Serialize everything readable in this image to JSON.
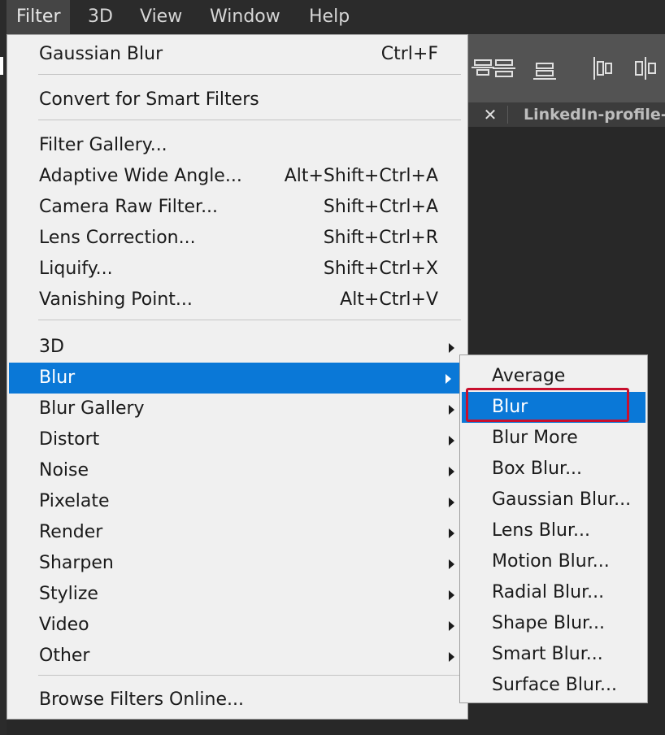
{
  "menubar": {
    "items": [
      {
        "label": "Filter"
      },
      {
        "label": "3D"
      },
      {
        "label": "View"
      },
      {
        "label": "Window"
      },
      {
        "label": "Help"
      }
    ]
  },
  "tabbar": {
    "close_glyph": "✕",
    "document_title": "LinkedIn-profile-"
  },
  "filter_menu": {
    "items": [
      {
        "label": "Gaussian Blur",
        "shortcut": "Ctrl+F"
      },
      {
        "label": "Convert for Smart Filters",
        "shortcut": ""
      },
      {
        "label": "Filter Gallery...",
        "shortcut": ""
      },
      {
        "label": "Adaptive Wide Angle...",
        "shortcut": "Alt+Shift+Ctrl+A"
      },
      {
        "label": "Camera Raw Filter...",
        "shortcut": "Shift+Ctrl+A"
      },
      {
        "label": "Lens Correction...",
        "shortcut": "Shift+Ctrl+R"
      },
      {
        "label": "Liquify...",
        "shortcut": "Shift+Ctrl+X"
      },
      {
        "label": "Vanishing Point...",
        "shortcut": "Alt+Ctrl+V"
      },
      {
        "label": "3D"
      },
      {
        "label": "Blur"
      },
      {
        "label": "Blur Gallery"
      },
      {
        "label": "Distort"
      },
      {
        "label": "Noise"
      },
      {
        "label": "Pixelate"
      },
      {
        "label": "Render"
      },
      {
        "label": "Sharpen"
      },
      {
        "label": "Stylize"
      },
      {
        "label": "Video"
      },
      {
        "label": "Other"
      },
      {
        "label": "Browse Filters Online..."
      }
    ]
  },
  "blur_submenu": {
    "items": [
      {
        "label": "Average"
      },
      {
        "label": "Blur"
      },
      {
        "label": "Blur More"
      },
      {
        "label": "Box Blur..."
      },
      {
        "label": "Gaussian Blur..."
      },
      {
        "label": "Lens Blur..."
      },
      {
        "label": "Motion Blur..."
      },
      {
        "label": "Radial Blur..."
      },
      {
        "label": "Shape Blur..."
      },
      {
        "label": "Smart Blur..."
      },
      {
        "label": "Surface Blur..."
      }
    ]
  },
  "colors": {
    "highlight": "#0a78d7",
    "annotation": "#c8102e",
    "menu_bg": "#f0f0f0",
    "menubar_bg": "#2b2b2b"
  },
  "icons": [
    "align-vertical-centers-icon",
    "align-bottom-edges-icon",
    "distribute-left-icon",
    "distribute-horizontal-centers-icon",
    "submenu-arrow-icon",
    "close-icon"
  ]
}
